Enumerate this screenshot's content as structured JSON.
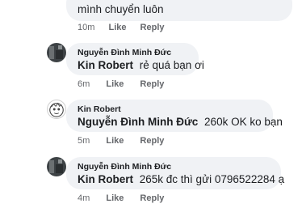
{
  "comments": [
    {
      "author": "",
      "mention": "",
      "text": "mình chuyển luôn",
      "time": "10m",
      "like": "Like",
      "reply": "Reply"
    },
    {
      "author": "Nguyễn Đình Minh Đức",
      "mention": "Kin Robert",
      "text": "rẻ quá bạn ơi",
      "time": "6m",
      "like": "Like",
      "reply": "Reply"
    },
    {
      "author": "Kin Robert",
      "mention": "Nguyễn Đình Minh Đức",
      "text": "260k OK ko bạn",
      "time": "5m",
      "like": "Like",
      "reply": "Reply"
    },
    {
      "author": "Nguyễn Đình Minh Đức",
      "mention": "Kin Robert",
      "text": "265k đc thì gửi 0796522284 ạ",
      "time": "4m",
      "like": "Like",
      "reply": "Reply"
    }
  ],
  "icons": {
    "avatar_minh_duc": "photo-avatar-icon",
    "avatar_kin_robert": "cartoon-face-avatar-icon"
  }
}
